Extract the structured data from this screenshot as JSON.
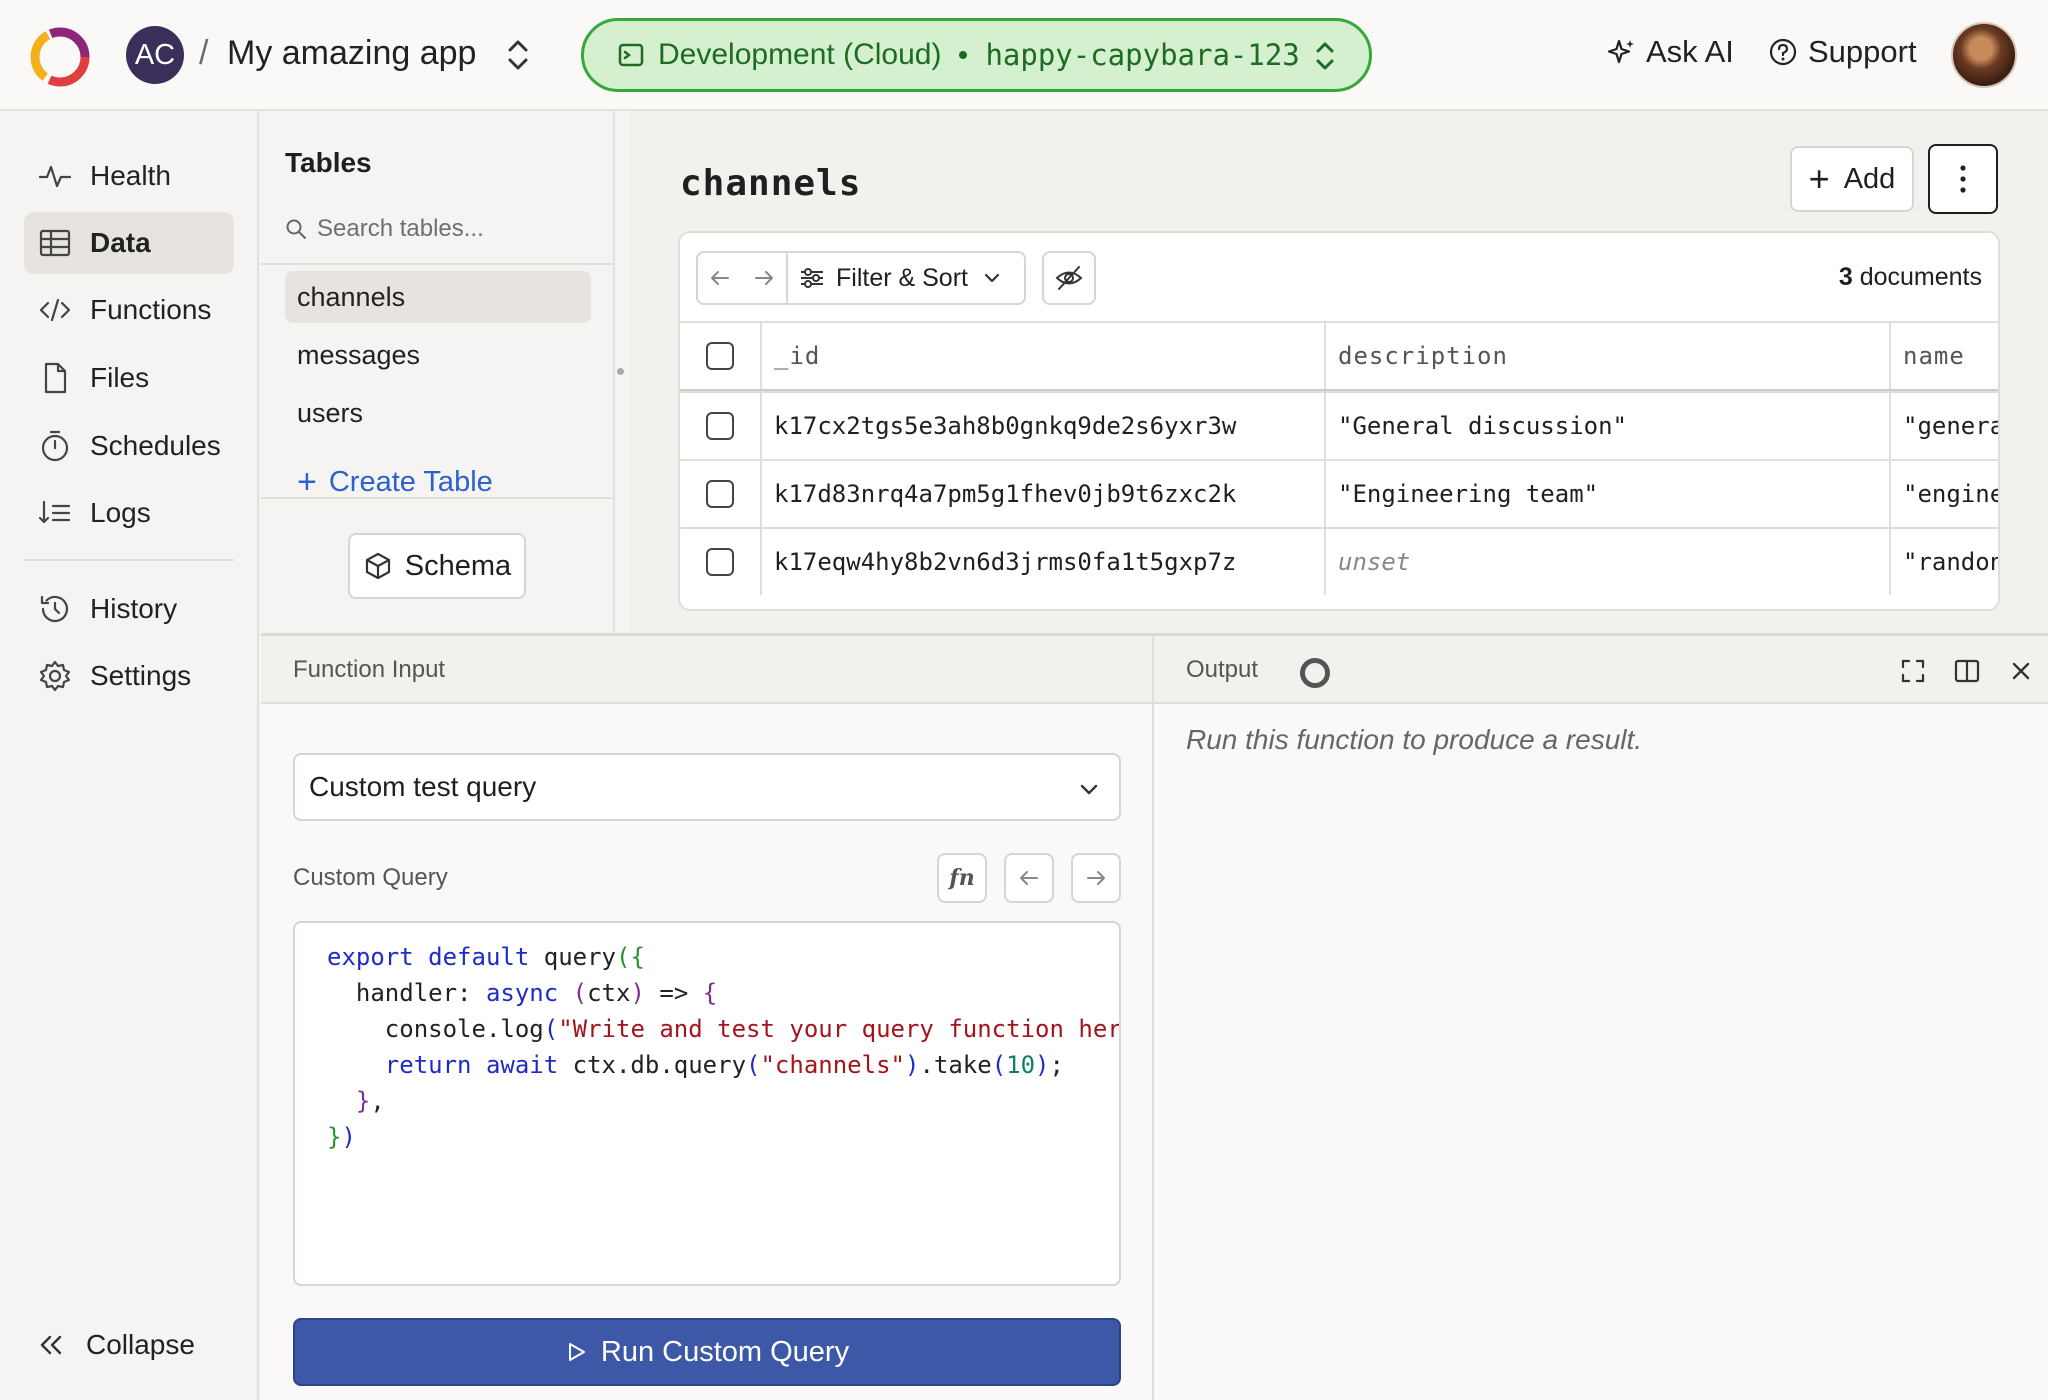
{
  "header": {
    "org_initials": "AC",
    "breadcrumb_sep": "/",
    "app_name": "My amazing app",
    "deployment": {
      "label": "Development (Cloud)",
      "name": "happy-capybara-123",
      "color": "#36a73b"
    },
    "ask_ai": "Ask AI",
    "support": "Support"
  },
  "nav": {
    "items": [
      {
        "label": "Health",
        "icon": "pulse-icon"
      },
      {
        "label": "Data",
        "icon": "table-icon",
        "active": true
      },
      {
        "label": "Functions",
        "icon": "code-icon"
      },
      {
        "label": "Files",
        "icon": "file-icon"
      },
      {
        "label": "Schedules",
        "icon": "timer-icon"
      },
      {
        "label": "Logs",
        "icon": "logs-icon"
      },
      {
        "label": "History",
        "icon": "history-icon"
      },
      {
        "label": "Settings",
        "icon": "gear-icon"
      }
    ],
    "collapse": "Collapse"
  },
  "tables": {
    "title": "Tables",
    "search_placeholder": "Search tables...",
    "items": [
      "channels",
      "messages",
      "users"
    ],
    "selected": "channels",
    "create": "Create Table",
    "schema": "Schema"
  },
  "data": {
    "table_name": "channels",
    "add": "Add",
    "filter_sort": "Filter & Sort",
    "doc_count": "3",
    "doc_count_label": "documents",
    "columns": [
      "_id",
      "description",
      "name"
    ],
    "rows": [
      {
        "_id": "k17cx2tgs5e3ah8b0gnkq9de2s6yxr3w",
        "description": "\"General discussion\"",
        "name": "\"genera"
      },
      {
        "_id": "k17d83nrq4a7pm5g1fhev0jb9t6zxc2k",
        "description": "\"Engineering team\"",
        "name": "\"engine"
      },
      {
        "_id": "k17eqw4hy8b2vn6d3jrms0fa1t5gxp7z",
        "description": "unset",
        "name": "\"randon"
      }
    ]
  },
  "function_input": {
    "title": "Function Input",
    "selected_function": "Custom test query",
    "custom_query_label": "Custom Query",
    "fn_button": "fn",
    "run_button": "Run Custom Query"
  },
  "output": {
    "title": "Output",
    "empty_text": "Run this function to produce a result."
  }
}
